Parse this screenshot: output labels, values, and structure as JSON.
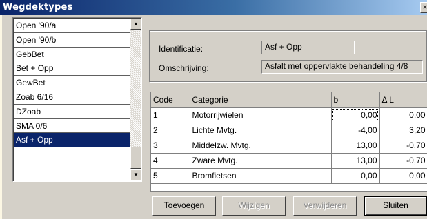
{
  "window": {
    "title": "Wegdektypes",
    "close_glyph": "x"
  },
  "list": {
    "items": [
      "Open '90/a",
      "Open '90/b",
      "GebBet",
      "Bet + Opp",
      "GewBet",
      "Zoab 6/16",
      "DZoab",
      "SMA 0/6",
      "Asf + Opp"
    ],
    "selected": "Asf + Opp"
  },
  "details": {
    "identificatie_label": "Identificatie:",
    "identificatie_value": "Asf + Opp",
    "omschrijving_label": "Omschrijving:",
    "omschrijving_value": "Asfalt met oppervlakte behandeling 4/8"
  },
  "table": {
    "headers": [
      "Code",
      "Categorie",
      "b",
      "Δ L"
    ],
    "rows": [
      [
        "1",
        "Motorrijwielen",
        "0,00",
        "0,00"
      ],
      [
        "2",
        "Lichte Mvtg.",
        "-4,00",
        "3,20"
      ],
      [
        "3",
        "Middelzw. Mvtg.",
        "13,00",
        "-0,70"
      ],
      [
        "4",
        "Zware Mvtg.",
        "13,00",
        "-0,70"
      ],
      [
        "5",
        "Bromfietsen",
        "0,00",
        "0,00"
      ]
    ]
  },
  "buttons": {
    "toevoegen": "Toevoegen",
    "wijzigen": "Wijzigen",
    "verwijderen": "Verwijderen",
    "sluiten": "Sluiten"
  },
  "icons": {
    "scroll_up": "arrow-up-icon",
    "scroll_down": "arrow-down-icon",
    "close": "close-icon"
  },
  "colors": {
    "titlebar_start": "#0a246a",
    "selection": "#0a246a",
    "background": "#fcf7e4",
    "face": "#d4d0c8"
  }
}
